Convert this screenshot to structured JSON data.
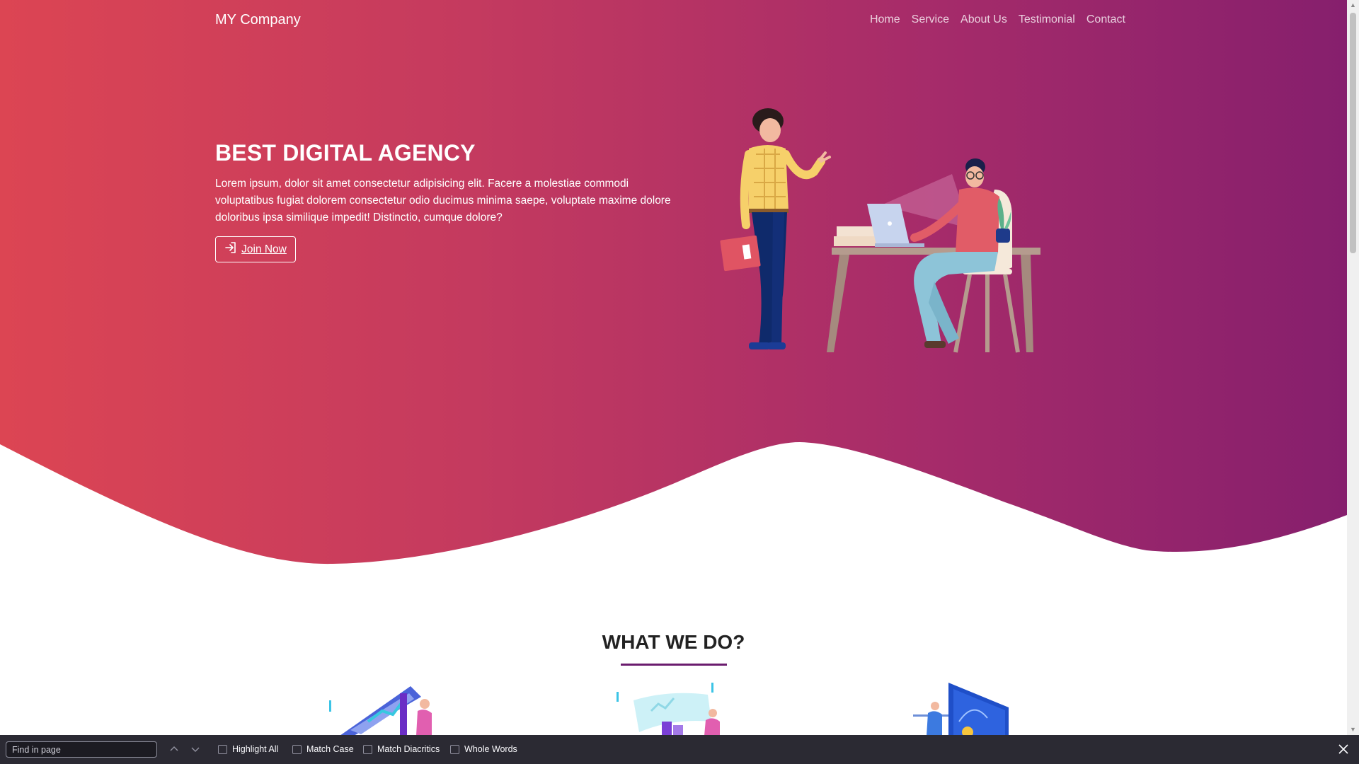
{
  "brand": "MY Company",
  "nav": [
    {
      "label": "Home"
    },
    {
      "label": "Service"
    },
    {
      "label": "About Us"
    },
    {
      "label": "Testimonial"
    },
    {
      "label": "Contact"
    }
  ],
  "hero": {
    "title": "BEST DIGITAL AGENCY",
    "text": "Lorem ipsum, dolor sit amet consectetur adipisicing elit. Facere a molestiae commodi voluptatibus fugiat dolorem consectetur odio ducimus minima saepe, voluptate maxime dolore doloribus ipsa similique impedit! Distinctio, cumque dolore?",
    "button_label": "Join Now",
    "button_icon": "sign-in-icon"
  },
  "section": {
    "title": "WHAT WE DO?"
  },
  "colors": {
    "gradient_start": "#dc4553",
    "gradient_end": "#861f6d",
    "underline": "#6b1c6e"
  },
  "findbar": {
    "placeholder": "Find in page",
    "options": [
      {
        "label": "Highlight All"
      },
      {
        "label": "Match Case"
      },
      {
        "label": "Match Diacritics"
      },
      {
        "label": "Whole Words"
      }
    ]
  }
}
